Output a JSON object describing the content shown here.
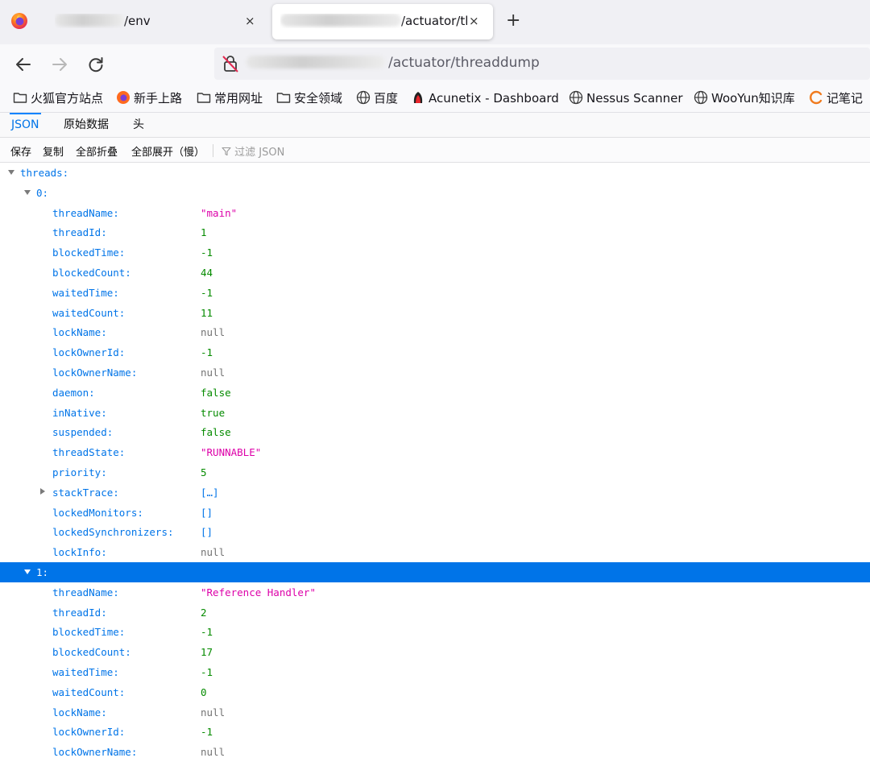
{
  "browser": {
    "tabs": [
      {
        "title_suffix": "/env",
        "close": "×"
      },
      {
        "title_suffix": "/actuator/tl",
        "close": "×",
        "active": true
      }
    ],
    "new_tab": "+",
    "url_suffix": "/actuator/threaddump"
  },
  "bookmarks": [
    {
      "label": "火狐官方站点",
      "icon": "folder-icon"
    },
    {
      "label": "新手上路",
      "icon": "firefox-icon"
    },
    {
      "label": "常用网址",
      "icon": "folder-icon"
    },
    {
      "label": "安全领域",
      "icon": "folder-icon"
    },
    {
      "label": "百度",
      "icon": "globe-icon"
    },
    {
      "label": "Acunetix - Dashboard",
      "icon": "acunetix-icon"
    },
    {
      "label": "Nessus Scanner",
      "icon": "globe-icon"
    },
    {
      "label": "WooYun知识库",
      "icon": "globe-icon"
    },
    {
      "label": "记笔记",
      "icon": "note-icon"
    }
  ],
  "viewer": {
    "tabs": [
      "JSON",
      "原始数据",
      "头"
    ],
    "toolbar": {
      "save": "保存",
      "copy": "复制",
      "collapse_all": "全部折叠",
      "expand_all": "全部展开（慢）",
      "filter_placeholder": "过滤 JSON"
    }
  },
  "colors": {
    "key": "#0074e8",
    "string": "#dd00a9",
    "number_bool": "#058b00",
    "null": "#737373",
    "selected_row": "#0074e8"
  },
  "json_rows": [
    {
      "key": "threads:",
      "val": "",
      "indent": 0,
      "twisty": "down"
    },
    {
      "key": "0:",
      "val": "",
      "indent": 1,
      "twisty": "down"
    },
    {
      "key": "threadName:",
      "val": "\"main\"",
      "type": "string",
      "indent": 2
    },
    {
      "key": "threadId:",
      "val": "1",
      "type": "number",
      "indent": 2
    },
    {
      "key": "blockedTime:",
      "val": "-1",
      "type": "number",
      "indent": 2
    },
    {
      "key": "blockedCount:",
      "val": "44",
      "type": "number",
      "indent": 2
    },
    {
      "key": "waitedTime:",
      "val": "-1",
      "type": "number",
      "indent": 2
    },
    {
      "key": "waitedCount:",
      "val": "11",
      "type": "number",
      "indent": 2
    },
    {
      "key": "lockName:",
      "val": "null",
      "type": "null",
      "indent": 2
    },
    {
      "key": "lockOwnerId:",
      "val": "-1",
      "type": "number",
      "indent": 2
    },
    {
      "key": "lockOwnerName:",
      "val": "null",
      "type": "null",
      "indent": 2
    },
    {
      "key": "daemon:",
      "val": "false",
      "type": "bool",
      "indent": 2
    },
    {
      "key": "inNative:",
      "val": "true",
      "type": "bool",
      "indent": 2
    },
    {
      "key": "suspended:",
      "val": "false",
      "type": "bool",
      "indent": 2
    },
    {
      "key": "threadState:",
      "val": "\"RUNNABLE\"",
      "type": "string",
      "indent": 2
    },
    {
      "key": "priority:",
      "val": "5",
      "type": "number",
      "indent": 2
    },
    {
      "key": "stackTrace:",
      "val": "[…]",
      "type": "array",
      "indent": 2,
      "twisty": "right"
    },
    {
      "key": "lockedMonitors:",
      "val": "[]",
      "type": "array",
      "indent": 2
    },
    {
      "key": "lockedSynchronizers:",
      "val": "[]",
      "type": "array",
      "indent": 2
    },
    {
      "key": "lockInfo:",
      "val": "null",
      "type": "null",
      "indent": 2
    },
    {
      "key": "1:",
      "val": "",
      "indent": 1,
      "twisty": "down",
      "selected": true
    },
    {
      "key": "threadName:",
      "val": "\"Reference Handler\"",
      "type": "string",
      "indent": 2
    },
    {
      "key": "threadId:",
      "val": "2",
      "type": "number",
      "indent": 2
    },
    {
      "key": "blockedTime:",
      "val": "-1",
      "type": "number",
      "indent": 2
    },
    {
      "key": "blockedCount:",
      "val": "17",
      "type": "number",
      "indent": 2
    },
    {
      "key": "waitedTime:",
      "val": "-1",
      "type": "number",
      "indent": 2
    },
    {
      "key": "waitedCount:",
      "val": "0",
      "type": "number",
      "indent": 2
    },
    {
      "key": "lockName:",
      "val": "null",
      "type": "null",
      "indent": 2
    },
    {
      "key": "lockOwnerId:",
      "val": "-1",
      "type": "number",
      "indent": 2
    },
    {
      "key": "lockOwnerName:",
      "val": "null",
      "type": "null",
      "indent": 2
    }
  ]
}
